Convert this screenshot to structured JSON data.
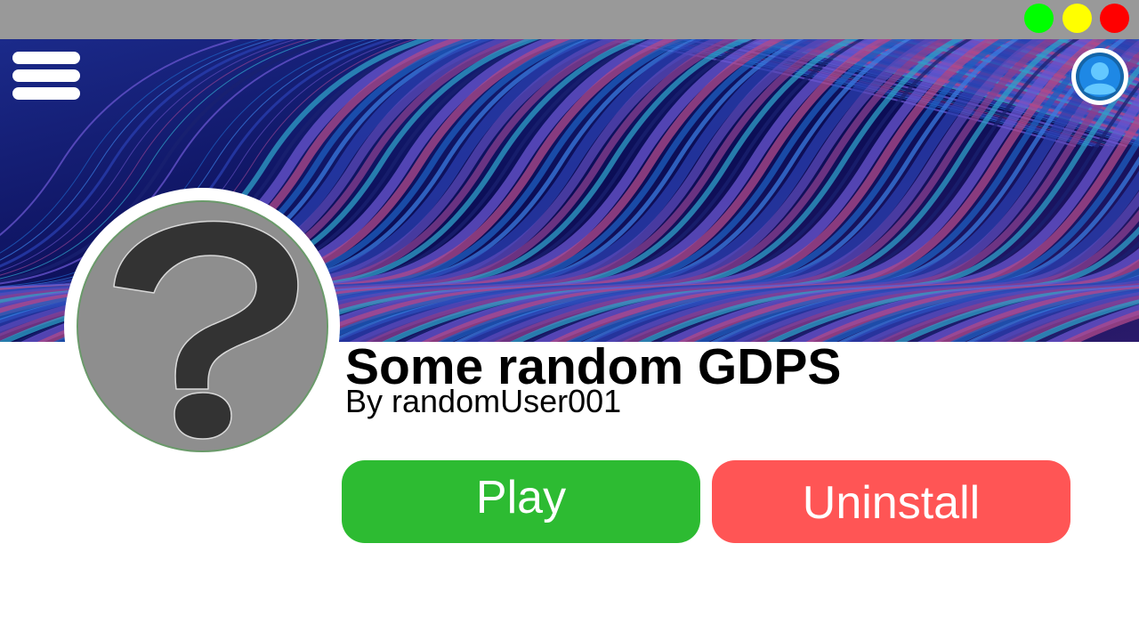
{
  "window": {
    "controls": [
      {
        "name": "green",
        "color": "#00ff00"
      },
      {
        "name": "yellow",
        "color": "#ffff00"
      },
      {
        "name": "red",
        "color": "#ff0000"
      }
    ]
  },
  "header": {
    "menu_icon": "hamburger-menu-icon",
    "profile_icon": "user-avatar-icon"
  },
  "server": {
    "icon": "question-mark-icon",
    "title": "Some random GDPS",
    "author": "By randomUser001"
  },
  "actions": {
    "play_label": "Play",
    "play_color": "#2dbb32",
    "uninstall_label": "Uninstall",
    "uninstall_color": "#ff5555"
  }
}
